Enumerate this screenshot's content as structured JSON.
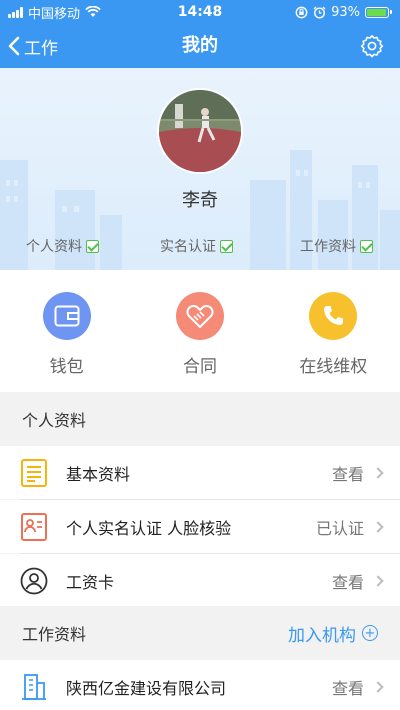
{
  "status_bar": {
    "carrier": "中国移动",
    "time": "14:48",
    "battery_percent": "93%",
    "battery_level": 0.93
  },
  "nav": {
    "back_label": "工作",
    "title": "我的"
  },
  "profile": {
    "name": "李奇",
    "badges": [
      {
        "label": "个人资料"
      },
      {
        "label": "实名认证"
      },
      {
        "label": "工作资料"
      }
    ]
  },
  "quick_actions": [
    {
      "label": "钱包",
      "color": "#6f95f3",
      "icon": "wallet-icon"
    },
    {
      "label": "合同",
      "color": "#f58a77",
      "icon": "handshake-icon"
    },
    {
      "label": "在线维权",
      "color": "#f7c12d",
      "icon": "phone-icon"
    }
  ],
  "personal_section": {
    "title": "个人资料",
    "items": [
      {
        "label": "基本资料",
        "value": "查看",
        "icon": "document-icon"
      },
      {
        "label": "个人实名认证 人脸核验",
        "value": "已认证",
        "icon": "id-card-icon"
      },
      {
        "label": "工资卡",
        "value": "查看",
        "icon": "user-card-icon"
      }
    ]
  },
  "work_section": {
    "title": "工作资料",
    "add_label": "加入机构",
    "items": [
      {
        "label": "陕西亿金建设有限公司",
        "value": "查看",
        "icon": "building-icon"
      }
    ]
  },
  "colors": {
    "primary": "#3a98f2",
    "check_green": "#4cc14c"
  }
}
